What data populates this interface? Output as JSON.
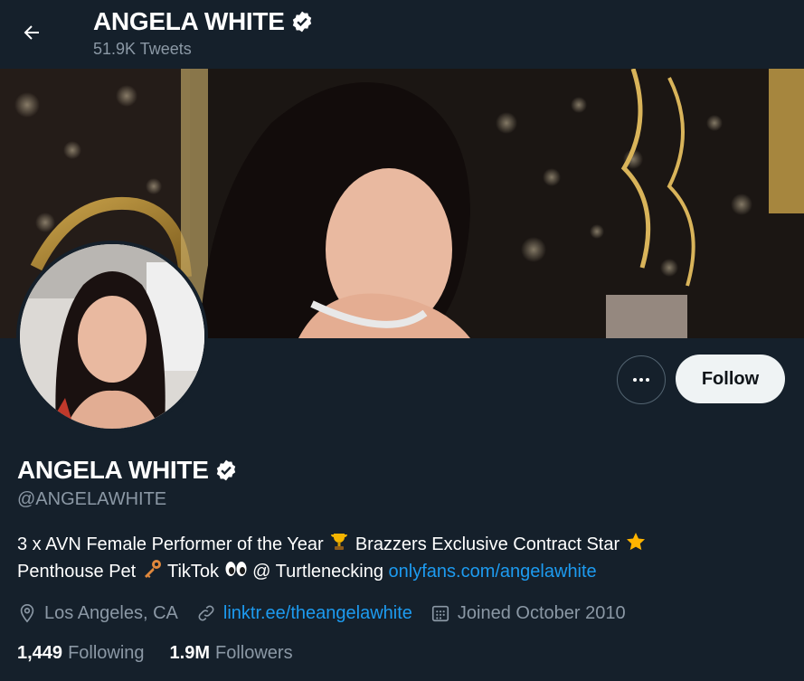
{
  "header": {
    "back_icon": "arrow-left-icon",
    "title": "ANGELA WHITE",
    "tweet_count": "51.9K Tweets"
  },
  "profile": {
    "name": "ANGELA WHITE",
    "handle": "@ANGELAWHITE",
    "verified_icon": "verified-badge-icon",
    "bio_line1_a": "3 x AVN Female Performer of the Year",
    "bio_line1_b": "Brazzers Exclusive Contract Star",
    "bio_line2_a": "Penthouse Pet",
    "bio_line2_b": "TikTok",
    "bio_line2_c": "@ Turtlenecking",
    "bio_link": "onlyfans.com/angelawhite",
    "location": "Los Angeles, CA",
    "website": "linktr.ee/theangelawhite",
    "joined": "Joined October 2010"
  },
  "actions": {
    "more_icon": "more-dots-icon",
    "follow_label": "Follow"
  },
  "stats": {
    "following_count": "1,449",
    "following_label": "Following",
    "followers_count": "1.9M",
    "followers_label": "Followers"
  },
  "colors": {
    "background": "#15202b",
    "accent": "#1d9bf0",
    "secondary_text": "#8b98a5"
  }
}
